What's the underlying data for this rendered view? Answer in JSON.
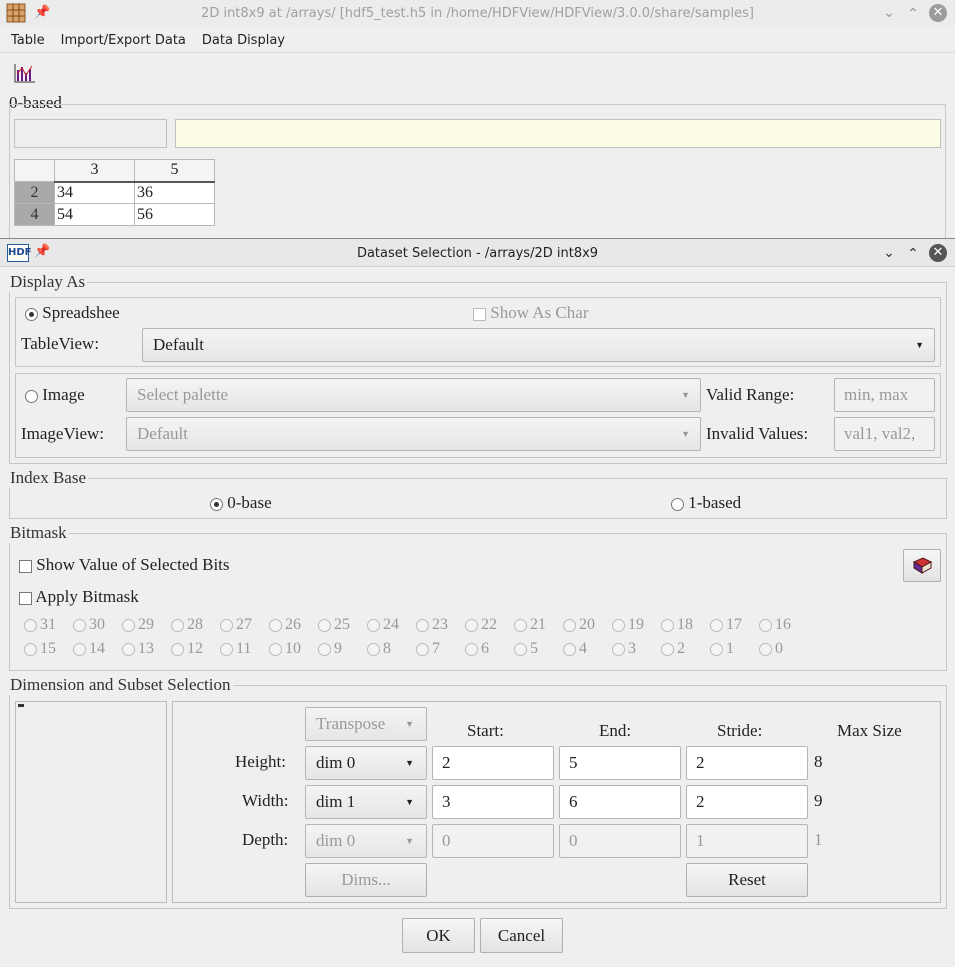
{
  "main_window": {
    "title": "2D int8x9  at  /arrays/  [hdf5_test.h5  in  /home/HDFView/HDFView/3.0.0/share/samples]",
    "menu": [
      "Table",
      "Import/Export Data",
      "Data Display"
    ],
    "index_base_label": "0-based",
    "table": {
      "columns": [
        "3",
        "5"
      ],
      "rows": [
        {
          "header": "2",
          "cells": [
            "34",
            "36"
          ]
        },
        {
          "header": "4",
          "cells": [
            "54",
            "56"
          ]
        }
      ]
    }
  },
  "dialog": {
    "title": "Dataset Selection - /arrays/2D int8x9",
    "display_as": {
      "legend": "Display As",
      "spreadsheet_label": "Spreadshee",
      "show_as_char_label": "Show As Char",
      "tableview_label": "TableView:",
      "tableview_value": "Default",
      "image_label": "Image",
      "palette_placeholder": "Select palette",
      "valid_range_label": "Valid Range:",
      "valid_range_placeholder": "min, max",
      "imageview_label": "ImageView:",
      "imageview_value": "Default",
      "invalid_values_label": "Invalid Values:",
      "invalid_values_placeholder": "val1, val2,"
    },
    "index_base": {
      "legend": "Index Base",
      "option0": "0-base",
      "option1": "1-based",
      "selected": "0-based"
    },
    "bitmask": {
      "legend": "Bitmask",
      "show_value_label": "Show Value of Selected Bits",
      "apply_label": "Apply Bitmask",
      "bits_row1": [
        "31",
        "30",
        "29",
        "28",
        "27",
        "26",
        "25",
        "24",
        "23",
        "22",
        "21",
        "20",
        "19",
        "18",
        "17",
        "16"
      ],
      "bits_row2": [
        "15",
        "14",
        "13",
        "12",
        "11",
        "10",
        "9",
        "8",
        "7",
        "6",
        "5",
        "4",
        "3",
        "2",
        "1",
        "0"
      ]
    },
    "dimension": {
      "legend": "Dimension and Subset Selection",
      "transpose_label": "Transpose",
      "start_header": "Start:",
      "end_header": "End:",
      "stride_header": "Stride:",
      "max_header": "Max Size",
      "height": {
        "label": "Height:",
        "dim": "dim 0",
        "start": "2",
        "end": "5",
        "stride": "2",
        "max": "8"
      },
      "width": {
        "label": "Width:",
        "dim": "dim 1",
        "start": "3",
        "end": "6",
        "stride": "2",
        "max": "9"
      },
      "depth": {
        "label": "Depth:",
        "dim": "dim 0",
        "start": "0",
        "end": "0",
        "stride": "1",
        "max": "1"
      },
      "dims_button": "Dims...",
      "reset_button": "Reset"
    },
    "ok_button": "OK",
    "cancel_button": "Cancel"
  }
}
